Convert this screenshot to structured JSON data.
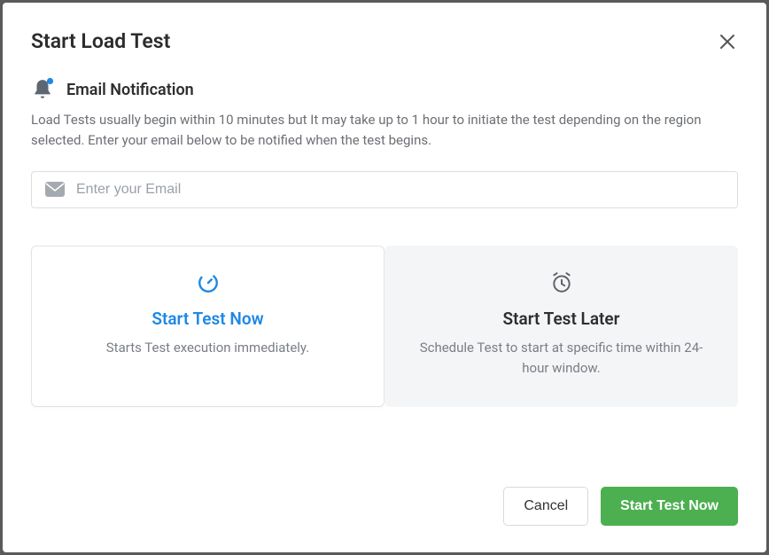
{
  "modal": {
    "title": "Start Load Test"
  },
  "section": {
    "title": "Email Notification",
    "description": "Load Tests usually begin within 10 minutes but It may take up to 1 hour to initiate the test depending on the region selected. Enter your email below to be notified when the test begins."
  },
  "email": {
    "placeholder": "Enter your Email",
    "value": ""
  },
  "options": {
    "now": {
      "title": "Start Test Now",
      "description": "Starts Test execution immediately."
    },
    "later": {
      "title": "Start Test Later",
      "description": "Schedule Test to start at specific time within 24-hour window."
    }
  },
  "footer": {
    "cancel": "Cancel",
    "submit": "Start Test Now"
  }
}
